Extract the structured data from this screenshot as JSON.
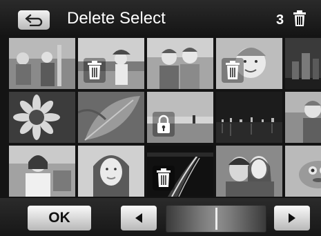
{
  "header": {
    "title": "Delete Select",
    "selected_count": "3",
    "back_icon": "return-arrow-icon",
    "trash_icon": "trash-icon"
  },
  "grid": {
    "rows": 3,
    "columns": 5,
    "thumbnails": [
      {
        "subject": "children-playground",
        "overlay": null
      },
      {
        "subject": "girl-on-beach",
        "overlay": "trash-icon"
      },
      {
        "subject": "two-children",
        "overlay": null
      },
      {
        "subject": "smiling-toddler",
        "overlay": "trash-icon"
      },
      {
        "subject": "city-skyline-night",
        "overlay": null
      },
      {
        "subject": "sunflower",
        "overlay": null
      },
      {
        "subject": "green-leaf",
        "overlay": null
      },
      {
        "subject": "person-on-beach",
        "overlay": "lock-icon"
      },
      {
        "subject": "harbor-night",
        "overlay": null
      },
      {
        "subject": "child-outdoors",
        "overlay": null
      },
      {
        "subject": "smiling-woman",
        "overlay": null
      },
      {
        "subject": "woman-portrait",
        "overlay": null
      },
      {
        "subject": "road-at-night",
        "overlay": "trash-icon"
      },
      {
        "subject": "couple-portrait",
        "overlay": null
      },
      {
        "subject": "toy-animal",
        "overlay": null
      }
    ]
  },
  "footer": {
    "ok_label": "OK",
    "prev_icon": "left-arrow-icon",
    "next_icon": "right-arrow-icon",
    "scroll_position": 0.5
  },
  "colors": {
    "background": "#141414",
    "button_light": "#fafafa",
    "button_dark": "#b8b8b8",
    "text": "#ffffff"
  }
}
